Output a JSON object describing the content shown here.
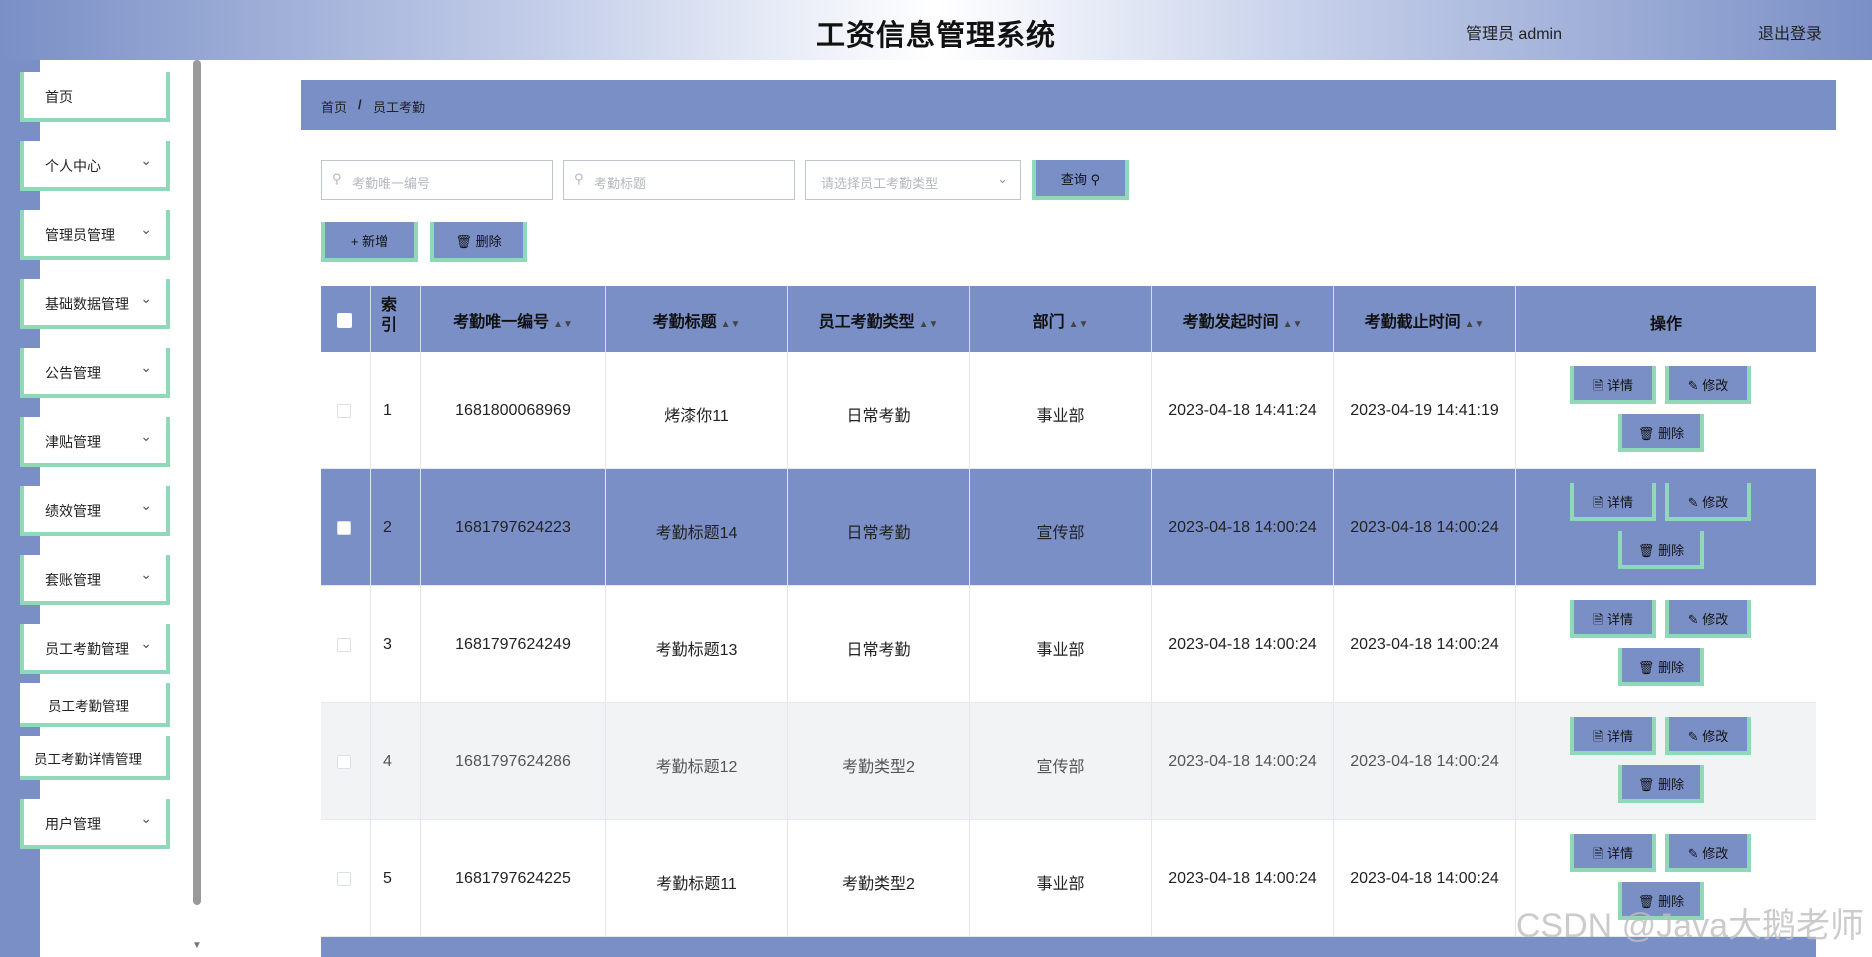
{
  "header": {
    "title": "工资信息管理系统",
    "user": "管理员 admin",
    "logout": "退出登录"
  },
  "sidebar": {
    "items": [
      {
        "label": "首页",
        "chevron": false
      },
      {
        "label": "个人中心",
        "chevron": true
      },
      {
        "label": "管理员管理",
        "chevron": true
      },
      {
        "label": "基础数据管理",
        "chevron": true
      },
      {
        "label": "公告管理",
        "chevron": true
      },
      {
        "label": "津贴管理",
        "chevron": true
      },
      {
        "label": "绩效管理",
        "chevron": true
      },
      {
        "label": "套账管理",
        "chevron": true
      },
      {
        "label": "员工考勤管理",
        "chevron": true
      }
    ],
    "subitems": [
      "员工考勤管理",
      "员工考勤详情管理"
    ],
    "last_item": "用户管理"
  },
  "breadcrumb": {
    "home": "首页",
    "sep": "/",
    "current": "员工考勤"
  },
  "search": {
    "id_placeholder": "考勤唯一编号",
    "title_placeholder": "考勤标题",
    "type_placeholder": "请选择员工考勤类型",
    "query_label": "查询"
  },
  "toolbar": {
    "add_label": "新增",
    "delete_label": "删除"
  },
  "table": {
    "headers": [
      "索引",
      "考勤唯一编号",
      "考勤标题",
      "员工考勤类型",
      "部门",
      "考勤发起时间",
      "考勤截止时间",
      "操作"
    ],
    "rows": [
      {
        "idx": "1",
        "code": "1681800068969",
        "title": "烤漆你11",
        "type": "日常考勤",
        "dept": "事业部",
        "start": "2023-04-18 14:41:24",
        "end": "2023-04-19 14:41:19"
      },
      {
        "idx": "2",
        "code": "1681797624223",
        "title": "考勤标题14",
        "type": "日常考勤",
        "dept": "宣传部",
        "start": "2023-04-18 14:00:24",
        "end": "2023-04-18 14:00:24"
      },
      {
        "idx": "3",
        "code": "1681797624249",
        "title": "考勤标题13",
        "type": "日常考勤",
        "dept": "事业部",
        "start": "2023-04-18 14:00:24",
        "end": "2023-04-18 14:00:24"
      },
      {
        "idx": "4",
        "code": "1681797624286",
        "title": "考勤标题12",
        "type": "考勤类型2",
        "dept": "宣传部",
        "start": "2023-04-18 14:00:24",
        "end": "2023-04-18 14:00:24"
      },
      {
        "idx": "5",
        "code": "1681797624225",
        "title": "考勤标题11",
        "type": "考勤类型2",
        "dept": "事业部",
        "start": "2023-04-18 14:00:24",
        "end": "2023-04-18 14:00:24"
      }
    ],
    "actions": {
      "detail": "详情",
      "edit": "修改",
      "delete": "删除"
    }
  },
  "watermark": "CSDN @Java大鹅老师",
  "colors": {
    "accent": "#7a8fc6",
    "border_accent": "#8fd8b8"
  }
}
